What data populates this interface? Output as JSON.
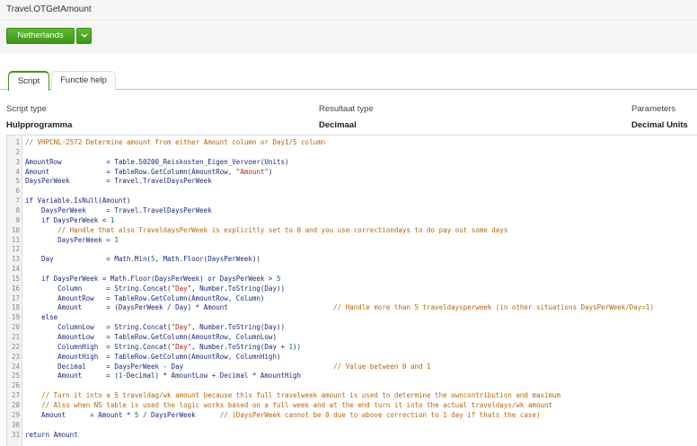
{
  "window": {
    "title": "Travel.OTGetAmount"
  },
  "toolbar": {
    "country": "Netherlands"
  },
  "tabs": [
    {
      "label": "Script",
      "active": true
    },
    {
      "label": "Functie help",
      "active": false
    }
  ],
  "meta": {
    "script_type_label": "Script type",
    "script_type_value": "Hulpprogramma",
    "result_type_label": "Resultaat type",
    "result_type_value": "Decimaal",
    "parameters_label": "Parameters",
    "parameters_value": "Decimal Units"
  },
  "colors": {
    "accent": "#4aa823",
    "comment": "#b8650a",
    "code": "#1e2a7a"
  },
  "code_lines": [
    "// VHPCNL-2572 Determine amount from either Amount column or Day1/5 column",
    "",
    "AmountRow           = Table.50200_Reiskosten_Eigen_Vervoer(Units)",
    "Amount              = TableRow.GetColumn(AmountRow, \"Amount\")",
    "DaysPerWeek         = Travel.TravelDaysPerWeek",
    "",
    "if Variable.IsNull(Amount)",
    "    DaysPerWeek     = Travel.TravelDaysPerWeek",
    "    if DaysPerWeek < 1",
    "        // Handle that also TraveldaysPerWeek is explicitly set to 0 and you use correctiondays to do pay out some days",
    "        DaysPerWeek = 1",
    "",
    "    Day             = Math.Min(5, Math.Floor(DaysPerWeek))",
    "",
    "    if DaysPerWeek = Math.Floor(DaysPerWeek) or DaysPerWeek > 5",
    "        Column      = String.Concat(\"Day\", Number.ToString(Day))",
    "        AmountRow   = TableRow.GetColumn(AmountRow, Column)",
    "        Amount      = (DaysPerWeek / Day) * Amount                          // Handle more than 5 traveldaysperweek (in other situations DaysPerWeek/Day=1)",
    "    else",
    "        ColumnLow   = String.Concat(\"Day\", Number.ToString(Day))",
    "        AmountLow   = TableRow.GetColumn(AmountRow, ColumnLow)",
    "        ColumnHigh  = String.Concat(\"Day\", Number.ToString(Day + 1))",
    "        AmountHigh  = TableRow.GetColumn(AmountRow, ColumnHigh)",
    "        Decimal     = DaysPerWeek - Day                                     // Value between 0 and 1",
    "        Amount      = (1-Decimal) * AmountLow + Decimal * AmountHigh",
    "",
    "    // Turn it into a 5 traveldag/wk amount because this full travelweek amount is used to determine the owncontribution and maximum",
    "    // Also when NS table is used the logic works based on a full week and at the end turn it into the actual traveldays/wk amount",
    "    Amount      = Amount * 5 / DaysPerWeek      // (DaysPerWeek cannot be 0 due to above correction to 1 day if thats the case)",
    "",
    "return Amount"
  ]
}
